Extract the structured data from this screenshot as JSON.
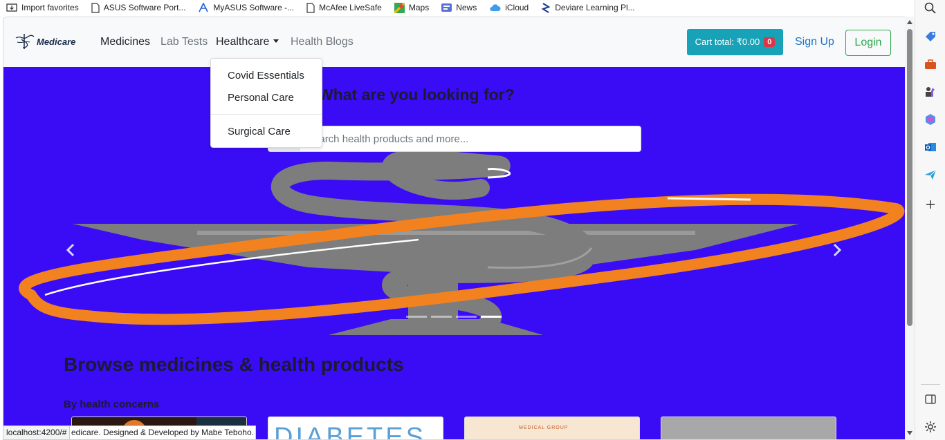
{
  "bookmarks": [
    {
      "label": "Import favorites",
      "icon": "import-icon"
    },
    {
      "label": "ASUS Software Port...",
      "icon": "page-icon"
    },
    {
      "label": "MyASUS Software -...",
      "icon": "myasus-icon"
    },
    {
      "label": "McAfee LiveSafe",
      "icon": "page-icon"
    },
    {
      "label": "Maps",
      "icon": "maps-icon"
    },
    {
      "label": "News",
      "icon": "news-icon"
    },
    {
      "label": "iCloud",
      "icon": "cloud-icon"
    },
    {
      "label": "Deviare Learning Pl...",
      "icon": "deviare-icon"
    }
  ],
  "navbar": {
    "brand": "Medicare",
    "links": {
      "medicines": "Medicines",
      "lab_tests": "Lab Tests",
      "healthcare": "Healthcare",
      "health_blogs": "Health Blogs"
    },
    "cart_label": "Cart total: ₹0.00",
    "cart_count": "0",
    "signup": "Sign Up",
    "login": "Login"
  },
  "dropdown": {
    "items": [
      "Covid Essentials",
      "Personal Care",
      "Surgical Care"
    ]
  },
  "hero": {
    "title": "What are you looking for?",
    "search_placeholder": "Search health products and more...",
    "slides_total": 4,
    "active_slide": 4
  },
  "browse": {
    "title": "Browse medicines & health products",
    "subtitle": "By health concerns",
    "cards": [
      "",
      "DIABETES",
      "MEDICAL GROUP",
      ""
    ]
  },
  "status": {
    "url": "localhost:4200/#",
    "footer": "edicare. Designed & Developed by Mabe Teboho."
  },
  "colors": {
    "hero_bg": "#3a0cf5",
    "cart_bg": "#17a2b8",
    "login_border": "#28a745",
    "signup_text": "#1a73c8",
    "badge_bg": "#dc3545"
  }
}
